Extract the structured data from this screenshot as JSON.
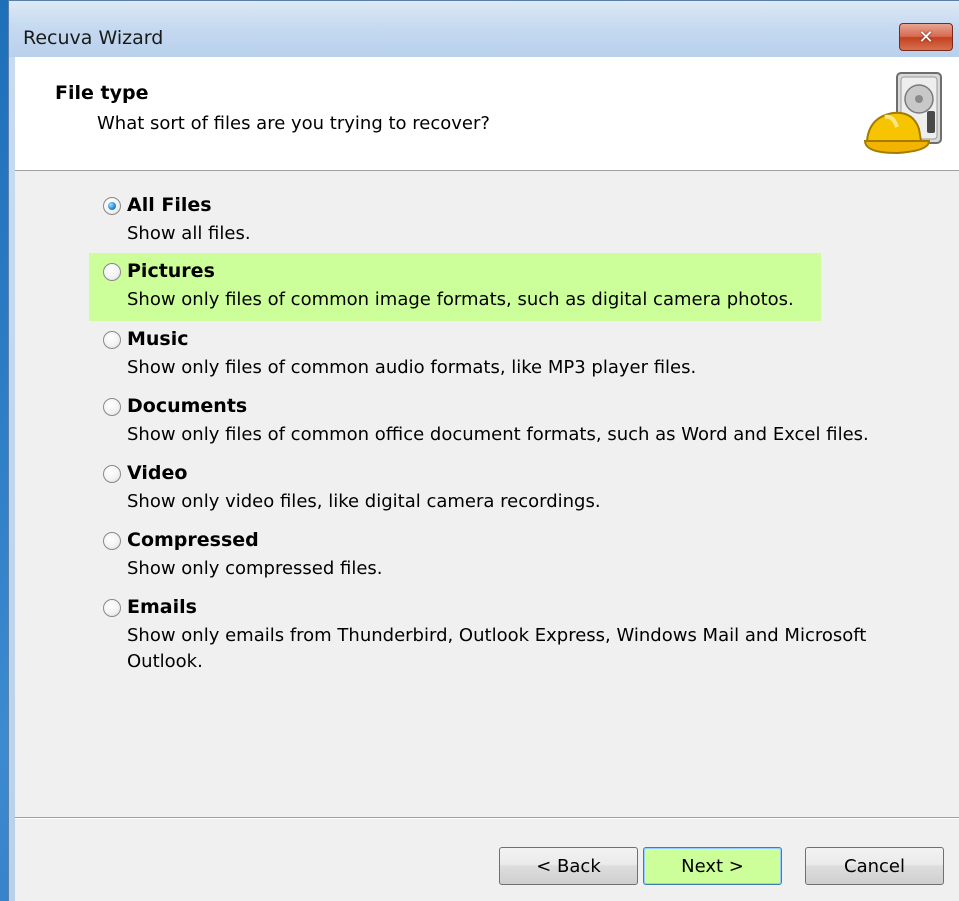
{
  "window": {
    "title": "Recuva Wizard",
    "close_label": "✕"
  },
  "header": {
    "title": "File type",
    "subtitle": "What sort of files are you trying to recover?"
  },
  "options": [
    {
      "label": "All Files",
      "description": "Show all files.",
      "selected": true
    },
    {
      "label": "Pictures",
      "description": "Show only files of common image formats, such as digital camera photos.",
      "selected": false
    },
    {
      "label": "Music",
      "description": "Show only files of common audio formats, like MP3 player files.",
      "selected": false
    },
    {
      "label": "Documents",
      "description": "Show only files of common office document formats, such as Word and Excel files.",
      "selected": false
    },
    {
      "label": "Video",
      "description": "Show only video files, like digital camera recordings.",
      "selected": false
    },
    {
      "label": "Compressed",
      "description": "Show only compressed files.",
      "selected": false
    },
    {
      "label": "Emails",
      "description": "Show only emails from Thunderbird, Outlook Express, Windows Mail and Microsoft Outlook.",
      "selected": false
    }
  ],
  "buttons": {
    "back": "< Back",
    "next": "Next >",
    "cancel": "Cancel"
  },
  "colors": {
    "highlight": "#ccff99",
    "title_bar": "#c6daf0",
    "close_button": "#c3401f"
  },
  "icons": {
    "header_icon": "hard-drive-hardhat-icon",
    "close": "close-icon"
  }
}
